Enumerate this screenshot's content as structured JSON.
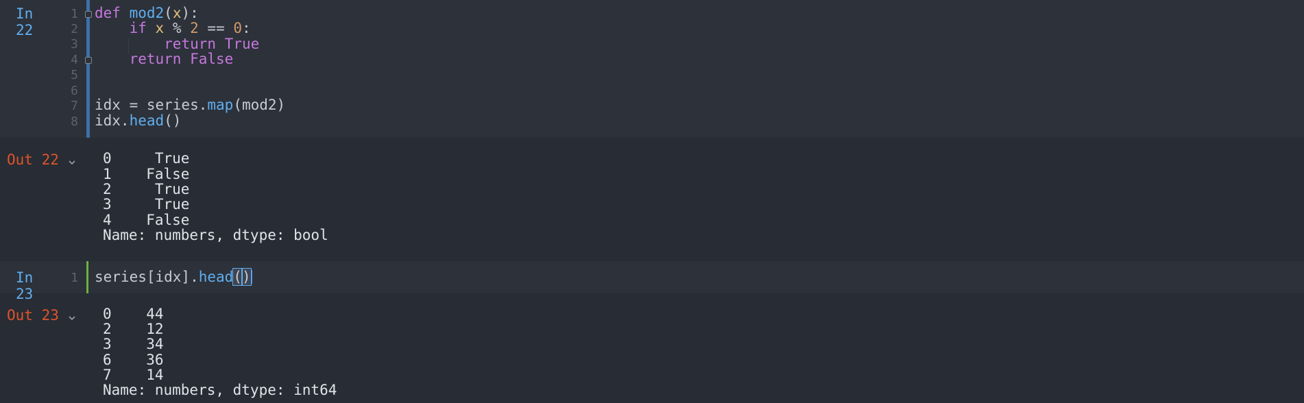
{
  "cells": [
    {
      "in_prompt": "In 22",
      "line_numbers": [
        "1",
        "2",
        "3",
        "4",
        "5",
        "6",
        "7",
        "8"
      ],
      "code": {
        "l1_def": "def",
        "l1_name": "mod2",
        "l1_open": "(",
        "l1_param": "x",
        "l1_close": "):",
        "l2_if": "if",
        "l2_x": "x",
        "l2_op": " % ",
        "l2_two": "2",
        "l2_eq": " == ",
        "l2_zero": "0",
        "l2_colon": ":",
        "l3_return": "return",
        "l3_true": "True",
        "l4_return": "return",
        "l4_false": "False",
        "l7_pre": "idx = series.",
        "l7_map": "map",
        "l7_post": "(mod2)",
        "l8_pre": "idx.",
        "l8_head": "head",
        "l8_post": "()"
      },
      "out_prompt": "Out 22",
      "output": [
        "0     True",
        "1    False",
        "2     True",
        "3     True",
        "4    False",
        "Name: numbers, dtype: bool"
      ]
    },
    {
      "in_prompt": "In 23",
      "line_numbers": [
        "1"
      ],
      "code": {
        "l1_pre": "series[idx].",
        "l1_head": "head",
        "l1_open": "(",
        "l1_close": ")"
      },
      "out_prompt": "Out 23",
      "output": [
        "0    44",
        "2    12",
        "3    34",
        "6    36",
        "7    14",
        "Name: numbers, dtype: int64"
      ]
    }
  ],
  "icons": {
    "collapse": "chevron-down-icon",
    "fold": "fold-marker-icon"
  },
  "colors": {
    "background": "#282c34",
    "input_cell": "#2c313a",
    "prompt_in": "#61afef",
    "prompt_out": "#e0542b",
    "keyword": "#c678dd",
    "function": "#61afef",
    "number": "#d19a66",
    "param": "#e5c07b",
    "active_bar": "#6db33f",
    "cell_bar": "#3f6fa6"
  }
}
